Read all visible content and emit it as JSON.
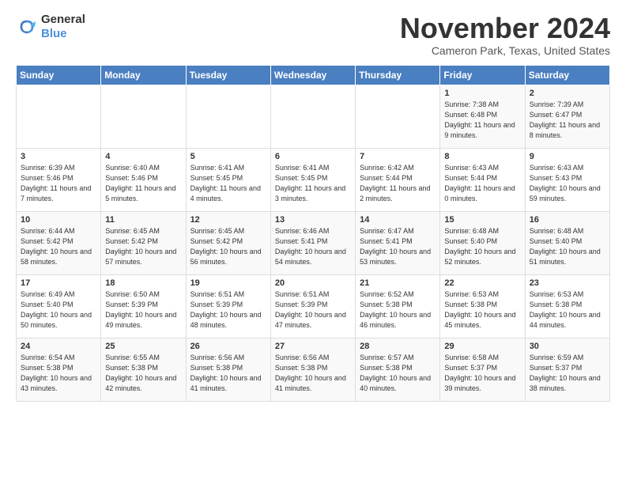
{
  "header": {
    "logo_general": "General",
    "logo_blue": "Blue",
    "month": "November 2024",
    "location": "Cameron Park, Texas, United States"
  },
  "weekdays": [
    "Sunday",
    "Monday",
    "Tuesday",
    "Wednesday",
    "Thursday",
    "Friday",
    "Saturday"
  ],
  "weeks": [
    [
      {
        "day": "",
        "info": ""
      },
      {
        "day": "",
        "info": ""
      },
      {
        "day": "",
        "info": ""
      },
      {
        "day": "",
        "info": ""
      },
      {
        "day": "",
        "info": ""
      },
      {
        "day": "1",
        "info": "Sunrise: 7:38 AM\nSunset: 6:48 PM\nDaylight: 11 hours and 9 minutes."
      },
      {
        "day": "2",
        "info": "Sunrise: 7:39 AM\nSunset: 6:47 PM\nDaylight: 11 hours and 8 minutes."
      }
    ],
    [
      {
        "day": "3",
        "info": "Sunrise: 6:39 AM\nSunset: 5:46 PM\nDaylight: 11 hours and 7 minutes."
      },
      {
        "day": "4",
        "info": "Sunrise: 6:40 AM\nSunset: 5:46 PM\nDaylight: 11 hours and 5 minutes."
      },
      {
        "day": "5",
        "info": "Sunrise: 6:41 AM\nSunset: 5:45 PM\nDaylight: 11 hours and 4 minutes."
      },
      {
        "day": "6",
        "info": "Sunrise: 6:41 AM\nSunset: 5:45 PM\nDaylight: 11 hours and 3 minutes."
      },
      {
        "day": "7",
        "info": "Sunrise: 6:42 AM\nSunset: 5:44 PM\nDaylight: 11 hours and 2 minutes."
      },
      {
        "day": "8",
        "info": "Sunrise: 6:43 AM\nSunset: 5:44 PM\nDaylight: 11 hours and 0 minutes."
      },
      {
        "day": "9",
        "info": "Sunrise: 6:43 AM\nSunset: 5:43 PM\nDaylight: 10 hours and 59 minutes."
      }
    ],
    [
      {
        "day": "10",
        "info": "Sunrise: 6:44 AM\nSunset: 5:42 PM\nDaylight: 10 hours and 58 minutes."
      },
      {
        "day": "11",
        "info": "Sunrise: 6:45 AM\nSunset: 5:42 PM\nDaylight: 10 hours and 57 minutes."
      },
      {
        "day": "12",
        "info": "Sunrise: 6:45 AM\nSunset: 5:42 PM\nDaylight: 10 hours and 56 minutes."
      },
      {
        "day": "13",
        "info": "Sunrise: 6:46 AM\nSunset: 5:41 PM\nDaylight: 10 hours and 54 minutes."
      },
      {
        "day": "14",
        "info": "Sunrise: 6:47 AM\nSunset: 5:41 PM\nDaylight: 10 hours and 53 minutes."
      },
      {
        "day": "15",
        "info": "Sunrise: 6:48 AM\nSunset: 5:40 PM\nDaylight: 10 hours and 52 minutes."
      },
      {
        "day": "16",
        "info": "Sunrise: 6:48 AM\nSunset: 5:40 PM\nDaylight: 10 hours and 51 minutes."
      }
    ],
    [
      {
        "day": "17",
        "info": "Sunrise: 6:49 AM\nSunset: 5:40 PM\nDaylight: 10 hours and 50 minutes."
      },
      {
        "day": "18",
        "info": "Sunrise: 6:50 AM\nSunset: 5:39 PM\nDaylight: 10 hours and 49 minutes."
      },
      {
        "day": "19",
        "info": "Sunrise: 6:51 AM\nSunset: 5:39 PM\nDaylight: 10 hours and 48 minutes."
      },
      {
        "day": "20",
        "info": "Sunrise: 6:51 AM\nSunset: 5:39 PM\nDaylight: 10 hours and 47 minutes."
      },
      {
        "day": "21",
        "info": "Sunrise: 6:52 AM\nSunset: 5:38 PM\nDaylight: 10 hours and 46 minutes."
      },
      {
        "day": "22",
        "info": "Sunrise: 6:53 AM\nSunset: 5:38 PM\nDaylight: 10 hours and 45 minutes."
      },
      {
        "day": "23",
        "info": "Sunrise: 6:53 AM\nSunset: 5:38 PM\nDaylight: 10 hours and 44 minutes."
      }
    ],
    [
      {
        "day": "24",
        "info": "Sunrise: 6:54 AM\nSunset: 5:38 PM\nDaylight: 10 hours and 43 minutes."
      },
      {
        "day": "25",
        "info": "Sunrise: 6:55 AM\nSunset: 5:38 PM\nDaylight: 10 hours and 42 minutes."
      },
      {
        "day": "26",
        "info": "Sunrise: 6:56 AM\nSunset: 5:38 PM\nDaylight: 10 hours and 41 minutes."
      },
      {
        "day": "27",
        "info": "Sunrise: 6:56 AM\nSunset: 5:38 PM\nDaylight: 10 hours and 41 minutes."
      },
      {
        "day": "28",
        "info": "Sunrise: 6:57 AM\nSunset: 5:38 PM\nDaylight: 10 hours and 40 minutes."
      },
      {
        "day": "29",
        "info": "Sunrise: 6:58 AM\nSunset: 5:37 PM\nDaylight: 10 hours and 39 minutes."
      },
      {
        "day": "30",
        "info": "Sunrise: 6:59 AM\nSunset: 5:37 PM\nDaylight: 10 hours and 38 minutes."
      }
    ]
  ]
}
